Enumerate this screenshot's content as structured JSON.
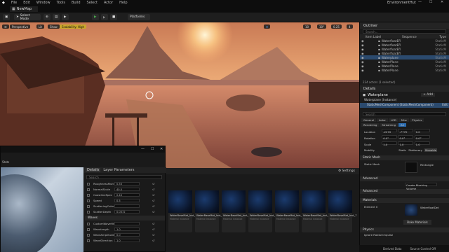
{
  "menu": [
    "File",
    "Edit",
    "Window",
    "Tools",
    "Build",
    "Select",
    "Actor",
    "Help"
  ],
  "project_name": "EnvironmentHut",
  "map_tab": "NewMap",
  "toolbar": {
    "select_mode": "Select Mode",
    "platforms": "Platforms"
  },
  "viewport": {
    "perspective": "Perspective",
    "lit": "Lit",
    "show": "Show",
    "scalability": "Scalability: High",
    "grid_snap": "10",
    "rot_snap": "10°",
    "scale_snap": "0.25",
    "cam_speed": "4"
  },
  "outliner": {
    "title": "Outliner",
    "search_placeholder": "Search...",
    "col_label": "Item Label",
    "col_sequence": "Sequence",
    "col_type": "Type",
    "rows": [
      {
        "label": "WaterfloatEfl",
        "type": "StaticM"
      },
      {
        "label": "WaterfloatEfl",
        "type": "StaticM"
      },
      {
        "label": "WaterfloatEfl",
        "type": "StaticM"
      },
      {
        "label": "WaterfloatEfl",
        "type": "StaticM"
      },
      {
        "label": "Waterplane",
        "type": "StaticM",
        "selected": true
      },
      {
        "label": "WaterPlane",
        "type": "StaticM"
      },
      {
        "label": "WaterPlane",
        "type": "StaticM"
      },
      {
        "label": "WaterPlane",
        "type": "StaticM"
      }
    ],
    "status": "234 actors (1 selected)"
  },
  "details": {
    "title": "Details",
    "actor": "Waterplane",
    "add": "+ Add",
    "instance": "Waterplane (Instance)",
    "component": "StaticMeshComponent (StaticMeshComponent)",
    "edit": "Edit",
    "search_placeholder": "Search",
    "tabs": [
      "General",
      "Actor",
      "LOD",
      "Misc",
      "Physics"
    ],
    "tabs2": [
      "Rendering",
      "Streaming",
      "All"
    ],
    "location_label": "Location",
    "rotation_label": "Rotation",
    "scale_label": "Scale",
    "location": [
      "-2270",
      "-7770",
      "0.0"
    ],
    "rotation": [
      "0.0°",
      "0.0°",
      "0.0°"
    ],
    "scale": [
      "1.0",
      "1.0",
      "1.0"
    ],
    "mobility_label": "Mobility",
    "mobility": [
      "Static",
      "Stationary",
      "Movable"
    ],
    "static_mesh_section": "Static Mesh",
    "static_mesh_label": "Static Mesh",
    "static_mesh_value": "Rectangle",
    "advanced": "Advanced",
    "advanced2": "Advanced",
    "collision_value": "Create Blocking Volume",
    "materials_section": "Materials",
    "element0_label": "Element 0",
    "element0_value": "WaterfloatDet",
    "bake": "Bake Materials",
    "physics_section": "Physics",
    "simulate": "Ignore Radial Impulse"
  },
  "content": {
    "settings": "Settings",
    "assets": [
      {
        "name": "WaterBaseMat_Inst_1",
        "type": "Material Instance"
      },
      {
        "name": "WaterBaseMat_Inst_2",
        "type": "Material Instance"
      },
      {
        "name": "WaterBaseMat_Inst_3",
        "type": "Material Instance"
      },
      {
        "name": "WaterBaseMat_Inst_4",
        "type": "Material Instance"
      },
      {
        "name": "WaterBaseMat_Inst_5",
        "type": "Material Instance"
      },
      {
        "name": "WaterBaseMat_Inst_6",
        "type": "Material Instance"
      },
      {
        "name": "WaterBaseMat_Inst_7",
        "type": "Material Instance"
      }
    ]
  },
  "material_window": {
    "title": "Instance Editor",
    "stats": "Stats",
    "details_tab": "Details",
    "params_tab": "Layer Parameters",
    "search_placeholder": "Search",
    "params": [
      {
        "label": "RoughnessMult",
        "value": "0.50"
      },
      {
        "label": "NormalScale",
        "value": "40.0"
      },
      {
        "label": "CoastlineSpec",
        "value": "0.40"
      },
      {
        "label": "Speed",
        "value": "0.5"
      },
      {
        "label": "ScatteringColor",
        "value": ""
      },
      {
        "label": "ScatterDepth",
        "value": "0.0072"
      }
    ],
    "group": "Waves",
    "params2": [
      {
        "label": "CustomWaveHt",
        "value": ""
      },
      {
        "label": "Wavelength",
        "value": "1.0"
      },
      {
        "label": "WaveAmplitude",
        "value": "0.0"
      },
      {
        "label": "WaveDirection",
        "value": "1.0"
      }
    ]
  },
  "statusbar": {
    "derived": "Derived Data",
    "source": "Source Control Off"
  }
}
